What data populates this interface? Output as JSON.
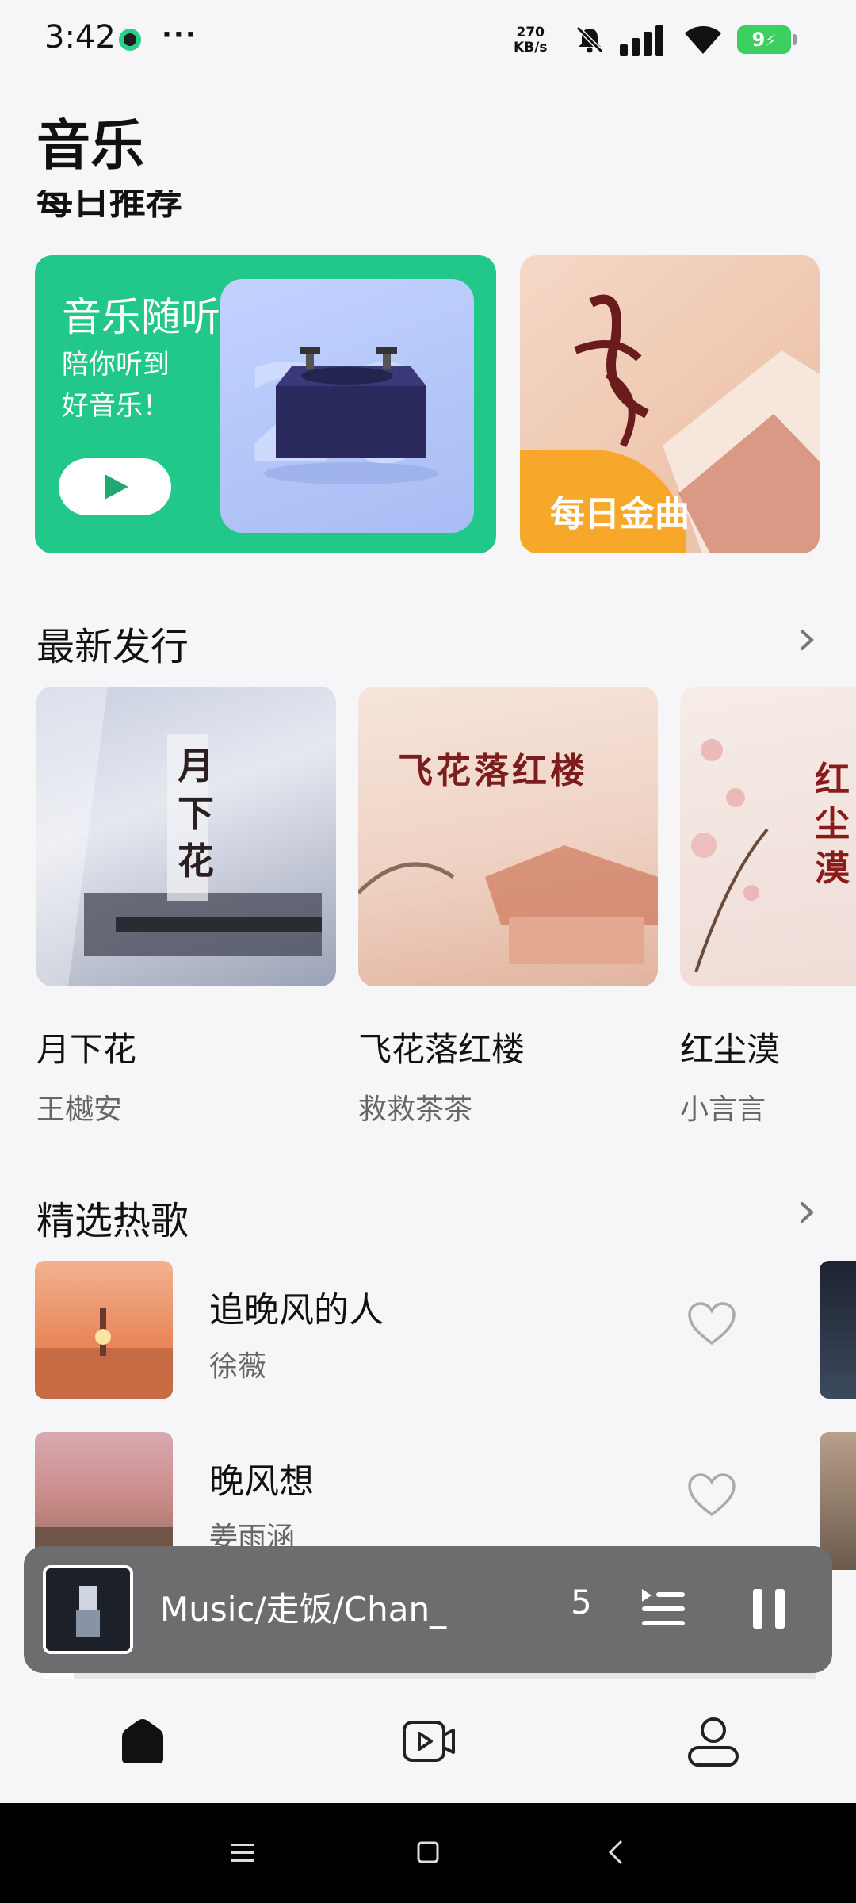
{
  "status": {
    "time": "3:42",
    "more": "···",
    "net_speed_value": "270",
    "net_speed_unit": "KB/s",
    "battery": "9"
  },
  "page": {
    "title": "音乐",
    "cut_section": "每日推荐"
  },
  "recommend": {
    "listen_title": "音乐随听",
    "listen_sub_1": "陪你听到",
    "listen_sub_2": "好音乐！",
    "daily_label": "每日金曲"
  },
  "new_releases": {
    "header": "最新发行",
    "albums": [
      {
        "name": "月下花",
        "artist": "王樾安",
        "art_text": "月下花"
      },
      {
        "name": "飞花落红楼",
        "artist": "救救茶茶",
        "art_text": "飞花落红楼"
      },
      {
        "name": "红尘漠",
        "artist": "小言言",
        "art_text": "红尘漠"
      }
    ]
  },
  "hot_songs": {
    "header": "精选热歌",
    "songs": [
      {
        "title": "追晚风的人",
        "artist": "徐薇"
      },
      {
        "title": "晚风想",
        "artist": "姜雨涵"
      }
    ]
  },
  "player": {
    "track": "Music/走饭/Chan_",
    "fade_char": "5",
    "progress": 0.04
  },
  "nav": {
    "items": [
      "home-icon",
      "video-icon",
      "profile-icon"
    ]
  },
  "colors": {
    "accent_green": "#22c78a",
    "daily_badge": "#f7a82a",
    "player_bg": "#6d6d6f"
  }
}
